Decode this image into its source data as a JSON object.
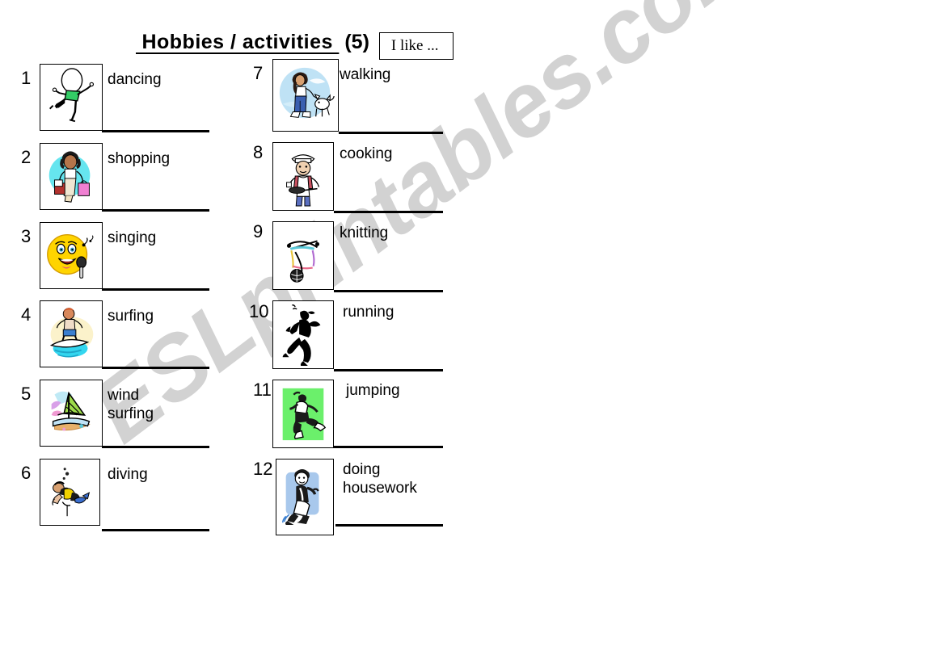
{
  "page": {
    "background_color": "#ffffff",
    "ink_color": "#000000"
  },
  "watermark": {
    "text": "ESLprintables.com",
    "color": "#d2d2d2",
    "rotation_deg": -37
  },
  "header": {
    "title": " Hobbies / activities ",
    "count": "(5)",
    "prompt_box": "I like ..."
  },
  "columns": [
    {
      "name": "left-column",
      "items": [
        {
          "number": "1",
          "label": "dancing",
          "icon": "dancing-clipart"
        },
        {
          "number": "2",
          "label": "shopping",
          "icon": "shopping-clipart"
        },
        {
          "number": "3",
          "label": "singing",
          "icon": "singing-clipart"
        },
        {
          "number": "4",
          "label": "surfing",
          "icon": "surfing-clipart"
        },
        {
          "number": "5",
          "label": "wind surfing",
          "icon": "wind-surfing-clipart"
        },
        {
          "number": "6",
          "label": "diving",
          "icon": "diving-clipart"
        }
      ]
    },
    {
      "name": "right-column",
      "items": [
        {
          "number": "7",
          "label": "walking",
          "icon": "walking-clipart"
        },
        {
          "number": "8",
          "label": "cooking",
          "icon": "cooking-clipart"
        },
        {
          "number": "9",
          "label": "knitting",
          "icon": "knitting-clipart"
        },
        {
          "number": "10",
          "label": "running",
          "icon": "running-clipart"
        },
        {
          "number": "11",
          "label": "jumping",
          "icon": "jumping-clipart"
        },
        {
          "number": "12",
          "label": "doing\nhousework",
          "icon": "housework-clipart"
        }
      ]
    }
  ],
  "colors": {
    "dancing_shirt": "#33cc66",
    "shopping_halo": "#66e5ef",
    "shopping_bag": "#f07fd2",
    "singing_face": "#ffd400",
    "surfing_water": "#33d6ef",
    "windsurf_sail": "#9ddb4a",
    "windsurf_sand": "#e8b06a",
    "diving_tank": "#f2d200",
    "walking_halo": "#bfe2f5",
    "cooking_shirt": "#c8505f",
    "cooking_pants": "#5a6fc0",
    "knitting_yarn": "#6fd4d4",
    "jumping_bg": "#6bf06b",
    "housework_halo": "#a8c8ec"
  }
}
